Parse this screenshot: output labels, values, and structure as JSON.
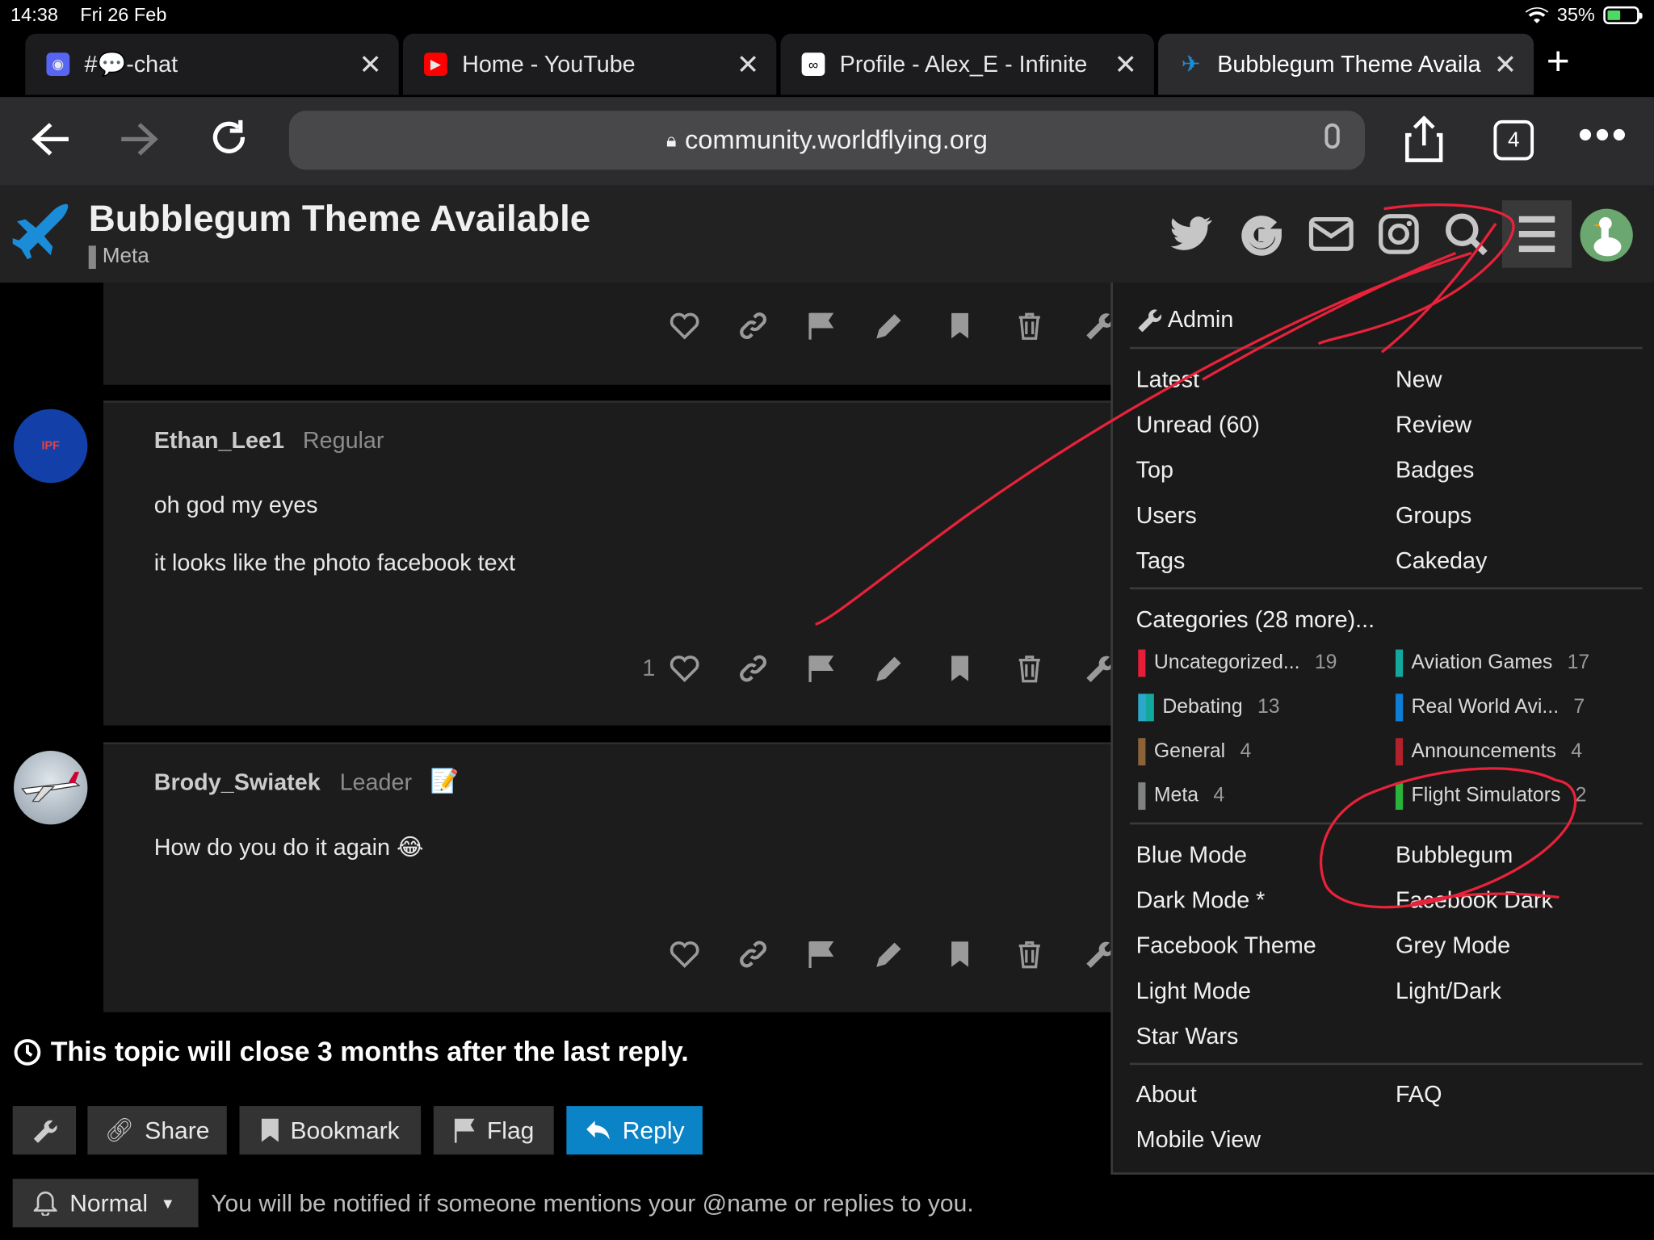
{
  "status": {
    "time": "14:38",
    "date": "Fri 26 Feb",
    "battery": "35%"
  },
  "tabs": [
    {
      "title": "#💬-chat",
      "icon": "discord-icon",
      "color": "#5865f2"
    },
    {
      "title": "Home - YouTube",
      "icon": "youtube-icon",
      "color": "#ff0000"
    },
    {
      "title": "Profile - Alex_E - Infinite",
      "icon": "infinite-icon",
      "color": "#000000"
    },
    {
      "title": "Bubblegum Theme Availa",
      "icon": "plane-icon",
      "color": "#1a8cd8"
    }
  ],
  "toolbar": {
    "url": "community.worldflying.org",
    "tab_count": "4"
  },
  "topic": {
    "title": "Bubblegum Theme Available",
    "category": "Meta"
  },
  "posts": [
    {
      "user": "Ethan_Lee1",
      "role": "Regular",
      "lines": [
        "oh god my eyes",
        "it looks like the photo facebook text"
      ],
      "likes": "1",
      "avatar_text": "IPF"
    },
    {
      "user": "Brody_Swiatek",
      "role": "Leader",
      "badge": "📝",
      "lines": [
        "How do you do it again 😂"
      ]
    }
  ],
  "footer": {
    "close_note": "This topic will close 3 months after the last reply.",
    "share": "Share",
    "bookmark": "Bookmark",
    "flag": "Flag",
    "reply": "Reply",
    "notify_level": "Normal",
    "notify_text": "You will be notified if someone mentions your @name or replies to you."
  },
  "menu": {
    "admin": "Admin",
    "links_left": [
      "Latest",
      "Unread (60)",
      "Top",
      "Users",
      "Tags"
    ],
    "links_right": [
      "New",
      "Review",
      "Badges",
      "Groups",
      "Cakeday"
    ],
    "categories_header": "Categories (28 more)...",
    "categories": [
      {
        "name": "Uncategorized...",
        "count": "19",
        "color": "#e61e3a"
      },
      {
        "name": "Aviation Games",
        "count": "17",
        "color": "#12a89d"
      },
      {
        "name": "Debating",
        "count": "13",
        "color": "#2aa7c9"
      },
      {
        "name": "Real World Avi...",
        "count": "7",
        "color": "#0d7ed8"
      },
      {
        "name": "General",
        "count": "4",
        "color": "#8c6238"
      },
      {
        "name": "Announcements",
        "count": "4",
        "color": "#b3212b"
      },
      {
        "name": "Meta",
        "count": "4",
        "color": "#808281"
      },
      {
        "name": "Flight Simulators",
        "count": "2",
        "color": "#2ab33a"
      }
    ],
    "themes_left": [
      "Blue Mode",
      "Dark Mode *",
      "Facebook Theme",
      "Light Mode",
      "Star Wars"
    ],
    "themes_right": [
      "Bubblegum",
      "Facebook Dark",
      "Grey Mode",
      "Light/Dark"
    ],
    "footer_left": [
      "About",
      "Mobile View"
    ],
    "footer_right": [
      "FAQ"
    ]
  },
  "colors": {
    "accent": "#0a84c6",
    "annotation": "#e8223a"
  }
}
